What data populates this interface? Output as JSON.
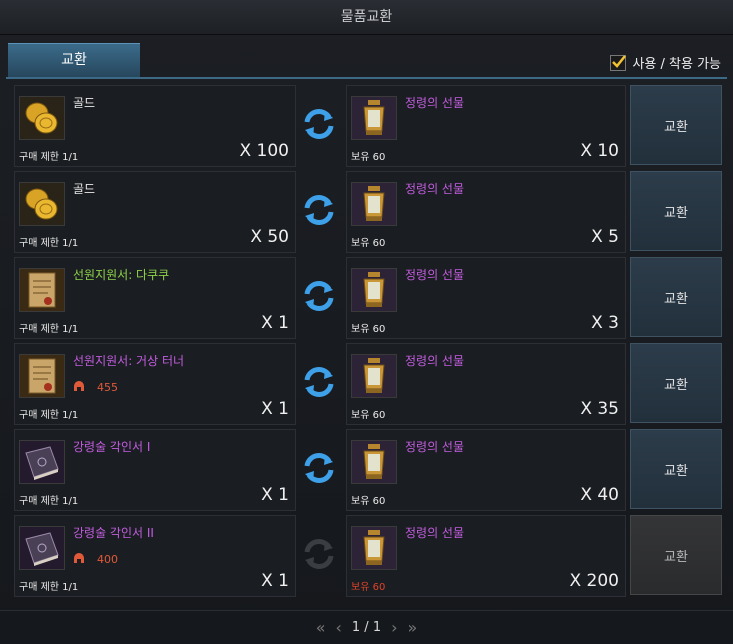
{
  "window": {
    "title": "물품교환"
  },
  "tabs": [
    {
      "label": "교환"
    }
  ],
  "filter": {
    "label": "사용 / 착용 가능",
    "checked": true
  },
  "rows": [
    {
      "cost_name": "골드",
      "cost_name_color": "#e8e8e8",
      "cost_icon": "gold-coins-icon",
      "cost_extra": "",
      "limit": "구매 제한 1/1",
      "cost_qty": "X 100",
      "reward_name": "정령의 선물",
      "reward_name_color": "#c35de0",
      "reward_icon": "lantern-icon",
      "owned": "보유 60",
      "owned_color": "#eaeaea",
      "reward_qty": "X 10",
      "button": "교환",
      "enabled": true
    },
    {
      "cost_name": "골드",
      "cost_name_color": "#e8e8e8",
      "cost_icon": "gold-coins-icon",
      "cost_extra": "",
      "limit": "구매 제한 1/1",
      "cost_qty": "X 50",
      "reward_name": "정령의 선물",
      "reward_name_color": "#c35de0",
      "reward_icon": "lantern-icon",
      "owned": "보유 60",
      "owned_color": "#eaeaea",
      "reward_qty": "X 5",
      "button": "교환",
      "enabled": true
    },
    {
      "cost_name": "선원지원서: 다쿠쿠",
      "cost_name_color": "#8fd34a",
      "cost_icon": "scroll-icon",
      "cost_extra": "",
      "limit": "구매 제한 1/1",
      "cost_qty": "X 1",
      "reward_name": "정령의 선물",
      "reward_name_color": "#c35de0",
      "reward_icon": "lantern-icon",
      "owned": "보유 60",
      "owned_color": "#eaeaea",
      "reward_qty": "X 3",
      "button": "교환",
      "enabled": true
    },
    {
      "cost_name": "선원지원서: 거상 터너",
      "cost_name_color": "#c35de0",
      "cost_icon": "scroll-icon",
      "cost_extra": "455",
      "limit": "구매 제한 1/1",
      "cost_qty": "X 1",
      "reward_name": "정령의 선물",
      "reward_name_color": "#c35de0",
      "reward_icon": "lantern-icon",
      "owned": "보유 60",
      "owned_color": "#eaeaea",
      "reward_qty": "X 35",
      "button": "교환",
      "enabled": true
    },
    {
      "cost_name": "강령술 각인서 I",
      "cost_name_color": "#c35de0",
      "cost_icon": "engraving-book-icon",
      "cost_extra": "",
      "limit": "구매 제한 1/1",
      "cost_qty": "X 1",
      "reward_name": "정령의 선물",
      "reward_name_color": "#c35de0",
      "reward_icon": "lantern-icon",
      "owned": "보유 60",
      "owned_color": "#eaeaea",
      "reward_qty": "X 40",
      "button": "교환",
      "enabled": true
    },
    {
      "cost_name": "강령술 각인서 II",
      "cost_name_color": "#c35de0",
      "cost_icon": "engraving-book-icon",
      "cost_extra": "400",
      "limit": "구매 제한 1/1",
      "cost_qty": "X 1",
      "reward_name": "정령의 선물",
      "reward_name_color": "#c35de0",
      "reward_icon": "lantern-icon",
      "owned": "보유 60",
      "owned_color": "#e0442a",
      "reward_qty": "X 200",
      "button": "교환",
      "enabled": false
    }
  ],
  "pager": {
    "first": "«",
    "prev": "‹",
    "page": "1 / 1",
    "next": "›",
    "last": "»"
  }
}
